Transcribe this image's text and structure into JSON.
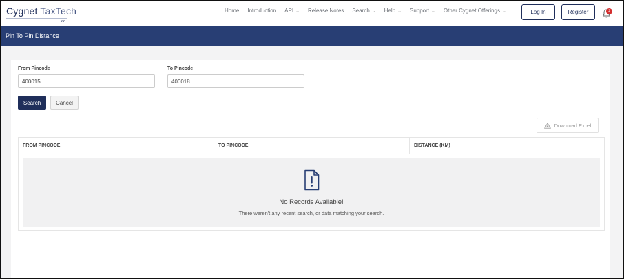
{
  "header": {
    "brand_main": "Cygnet ",
    "brand_accent": "TaxTech",
    "brand_sub": "IRP",
    "nav": [
      {
        "label": "Home",
        "dropdown": false
      },
      {
        "label": "Introduction",
        "dropdown": false
      },
      {
        "label": "API",
        "dropdown": true
      },
      {
        "label": "Release Notes",
        "dropdown": false
      },
      {
        "label": "Search",
        "dropdown": true
      },
      {
        "label": "Help",
        "dropdown": true
      },
      {
        "label": "Support",
        "dropdown": true
      },
      {
        "label": "Other Cygnet Offerings",
        "dropdown": true
      }
    ],
    "login_label": "Log In",
    "register_label": "Register",
    "notification_count": "2"
  },
  "page": {
    "title": "Pin To Pin Distance"
  },
  "form": {
    "from_label": "From Pincode",
    "from_value": "400015",
    "to_label": "To Pincode",
    "to_value": "400018",
    "search_label": "Search",
    "cancel_label": "Cancel"
  },
  "table": {
    "download_label": "Download Excel",
    "columns": [
      "FROM PINCODE",
      "TO PINCODE",
      "DISTANCE (KM)"
    ],
    "empty_title": "No Records Available!",
    "empty_message": "There weren't any recent search, or data matching your search."
  },
  "colors": {
    "primary": "#1f2e5a",
    "titlebar": "#283e74",
    "badge": "#d32f2f"
  }
}
